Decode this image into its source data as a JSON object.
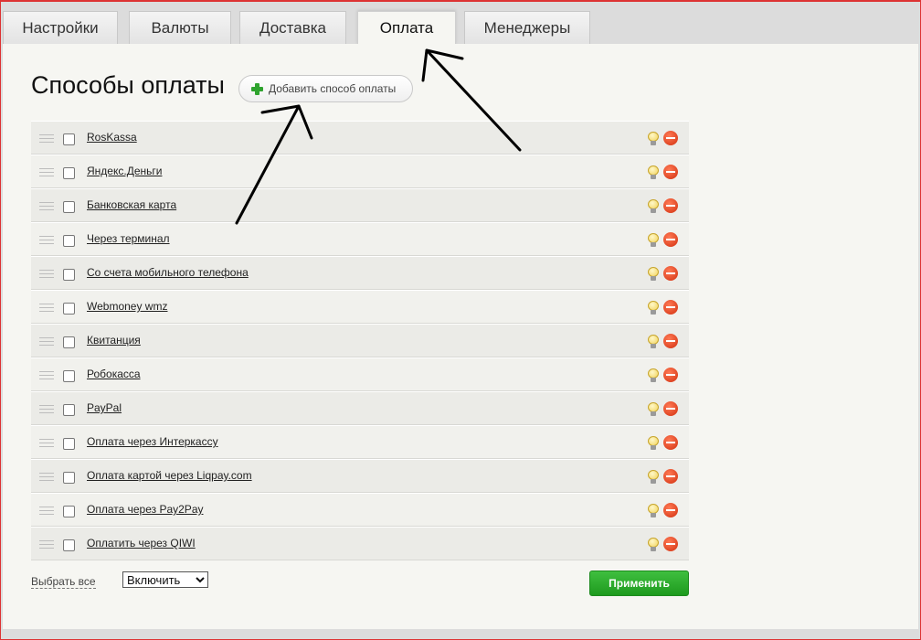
{
  "tabs": [
    {
      "label": "Настройки"
    },
    {
      "label": "Валюты"
    },
    {
      "label": "Доставка"
    },
    {
      "label": "Оплата",
      "active": true
    },
    {
      "label": "Менеджеры"
    }
  ],
  "page": {
    "title": "Способы оплаты",
    "add_button_label": "Добавить способ оплаты"
  },
  "payment_methods": [
    {
      "name": "RosKassa"
    },
    {
      "name": "Яндекс.Деньги"
    },
    {
      "name": "Банковская карта"
    },
    {
      "name": "Через терминал"
    },
    {
      "name": "Со счета мобильного телефона"
    },
    {
      "name": "Webmoney wmz"
    },
    {
      "name": "Квитанция"
    },
    {
      "name": "Робокасса"
    },
    {
      "name": "PayPal"
    },
    {
      "name": "Оплата через Интеркассу"
    },
    {
      "name": "Оплата картой через Liqpay.com"
    },
    {
      "name": "Оплата через Pay2Pay"
    },
    {
      "name": "Оплатить через QIWI"
    }
  ],
  "footer": {
    "select_all_label": "Выбрать все",
    "action_selected": "Включить",
    "apply_label": "Применить"
  },
  "icons": {
    "enable": "bulb-icon",
    "delete": "delete-icon",
    "drag": "drag-handle-icon",
    "add": "plus-icon"
  },
  "colors": {
    "accent_green": "#1e9a1e",
    "delete_red": "#d2300f",
    "frame_border": "#dd3333"
  }
}
